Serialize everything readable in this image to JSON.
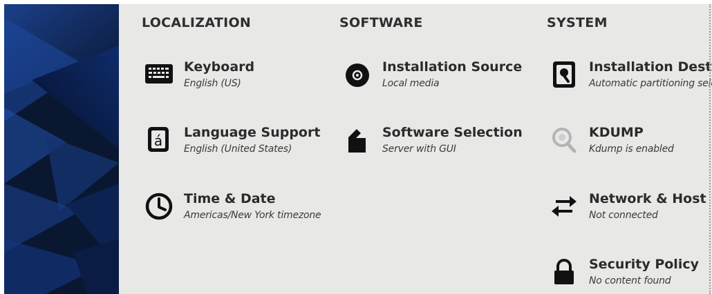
{
  "columns": {
    "localization": {
      "header": "LOCALIZATION",
      "spokes": [
        {
          "title": "Keyboard",
          "status": "English (US)",
          "icon": "keyboard-icon"
        },
        {
          "title": "Language Support",
          "status": "English (United States)",
          "icon": "language-icon"
        },
        {
          "title": "Time & Date",
          "status": "Americas/New York timezone",
          "icon": "clock-icon"
        }
      ]
    },
    "software": {
      "header": "SOFTWARE",
      "spokes": [
        {
          "title": "Installation Source",
          "status": "Local media",
          "icon": "disc-icon"
        },
        {
          "title": "Software Selection",
          "status": "Server with GUI",
          "icon": "package-icon"
        }
      ]
    },
    "system": {
      "header": "SYSTEM",
      "spokes": [
        {
          "title": "Installation Destin",
          "status": "Automatic partitioning sele",
          "icon": "harddisk-icon"
        },
        {
          "title": "KDUMP",
          "status": "Kdump is enabled",
          "icon": "magnifier-icon"
        },
        {
          "title": "Network & Host N",
          "status": "Not connected",
          "icon": "network-arrows-icon"
        },
        {
          "title": "Security Policy",
          "status": "No content found",
          "icon": "lock-icon"
        }
      ]
    }
  },
  "colors": {
    "background": "#e8e8e7",
    "sidebar": "#0b1a33",
    "icon": "#111111",
    "icon_disabled": "#b4b4b4",
    "text": "#2b2b2b"
  }
}
